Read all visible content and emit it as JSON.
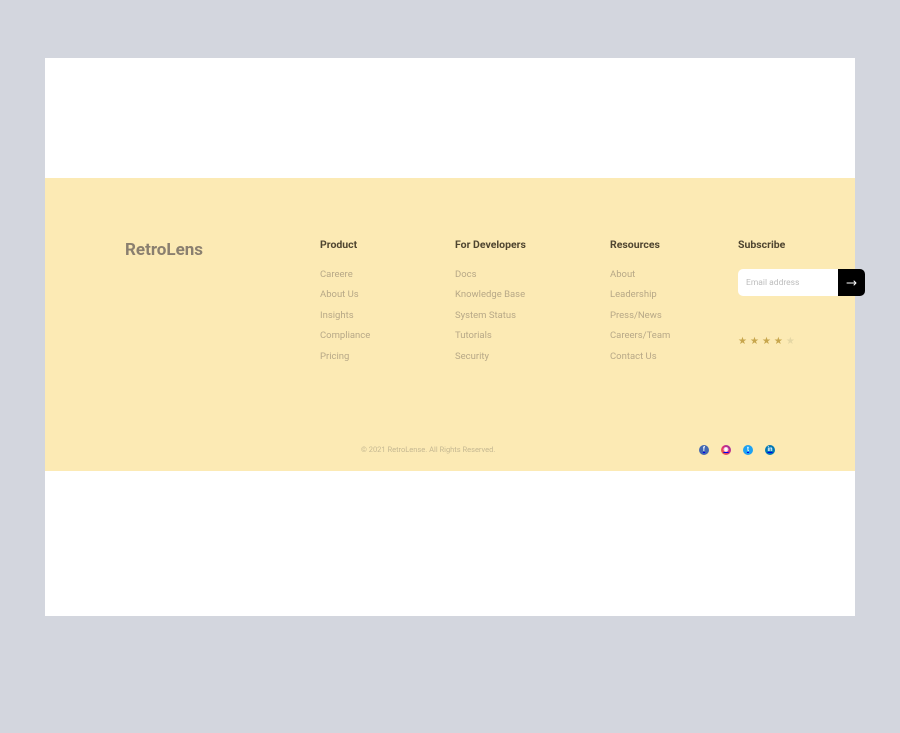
{
  "brand": "RetroLens",
  "columns": {
    "product": {
      "heading": "Product",
      "links": [
        "Careere",
        "About Us",
        "Insights",
        "Compliance",
        "Pricing"
      ]
    },
    "developers": {
      "heading": "For Developers",
      "links": [
        "Docs",
        "Knowledge Base",
        "System Status",
        "Tutorials",
        "Security"
      ]
    },
    "resources": {
      "heading": "Resources",
      "links": [
        "About",
        "Leadership",
        "Press/News",
        "Careers/Team",
        "Contact Us"
      ]
    }
  },
  "subscribe": {
    "heading": "Subscribe",
    "placeholder": "Email address"
  },
  "rating": {
    "stars": 4,
    "max": 5
  },
  "copyright": "© 2021 RetroLense. All Rights Reserved.",
  "social": {
    "facebook": "f",
    "instagram": "◉",
    "twitter": "t",
    "linkedin": "in"
  }
}
